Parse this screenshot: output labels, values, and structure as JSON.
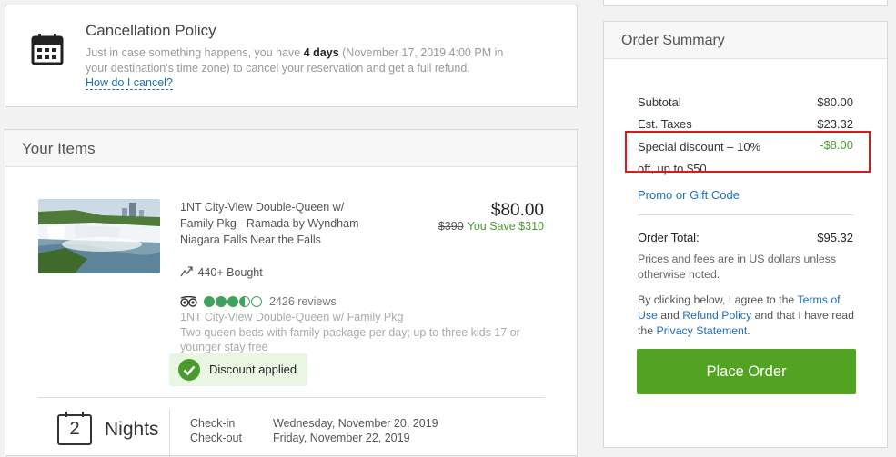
{
  "cancellation": {
    "title": "Cancellation Policy",
    "text_before": "Just in case something happens, you have ",
    "days": "4 days",
    "text_after": " (November 17, 2019 4:00 PM in your destination's time zone) to cancel your reservation and get a full refund.",
    "link": "How do I cancel?",
    "icon": "calendar-icon"
  },
  "items": {
    "title": "Your Items",
    "deal": {
      "description": "1NT City-View Double-Queen w/ Family Pkg - Ramada by Wyndham Niagara Falls Near the Falls",
      "price": "$80.00",
      "original_price": "$390",
      "you_save": "You Save $310",
      "bought": "440+ Bought",
      "rating_bubbles": 3.5,
      "reviews": "2426 reviews",
      "option_name": "1NT City-View Double-Queen w/ Family Pkg",
      "option_detail": "Two queen beds with family package per day; up to three kids 17 or younger stay free",
      "discount_badge": "Discount applied"
    },
    "stay": {
      "nights_count": "2",
      "nights_label": "Nights",
      "checkin_label": "Check-in",
      "checkout_label": "Check-out",
      "checkin_date": "Wednesday, November 20, 2019",
      "checkout_date": "Friday, November 22, 2019"
    }
  },
  "summary": {
    "title": "Order Summary",
    "subtotal_label": "Subtotal",
    "subtotal": "$80.00",
    "taxes_label": "Est. Taxes",
    "taxes": "$23.32",
    "discount_label": "Special discount – 10% off, up to $50",
    "discount": "-$8.00",
    "promo": "Promo or Gift Code",
    "total_label": "Order Total:",
    "total": "$95.32",
    "note": "Prices and fees are in US dollars unless otherwise noted.",
    "agree_1": "By clicking below, I agree to the ",
    "terms": "Terms of Use",
    "agree_2": " and ",
    "refund": "Refund Policy",
    "agree_3": " and that I have read the ",
    "privacy": "Privacy Statement",
    "agree_4": ".",
    "place_order": "Place Order"
  },
  "colors": {
    "accent_green": "#53a322",
    "link_blue": "#2071b8",
    "highlight_red": "#e01818"
  }
}
